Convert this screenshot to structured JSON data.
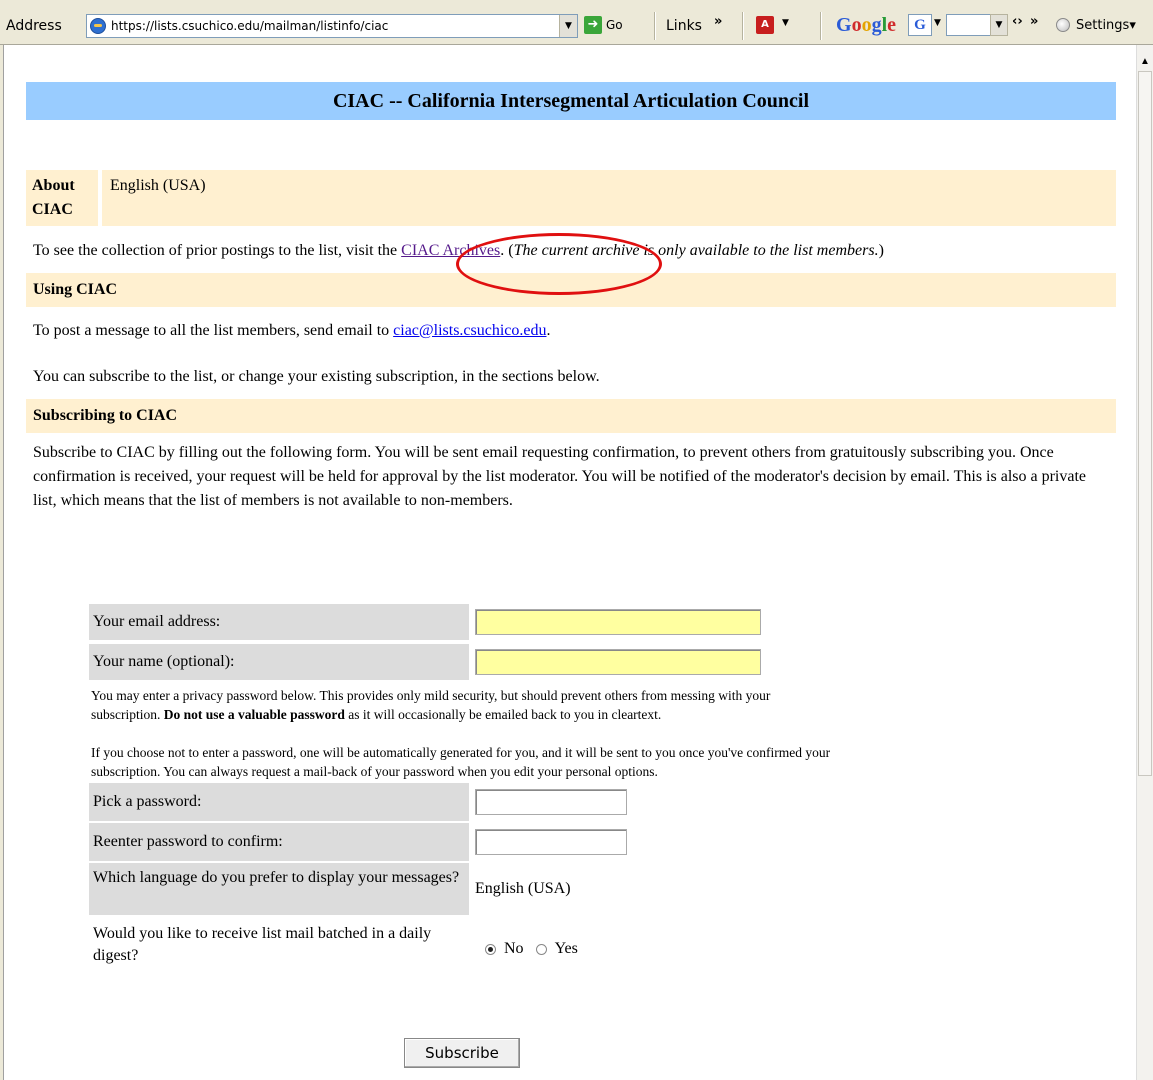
{
  "toolbar": {
    "address_label": "Address",
    "url": "https://lists.csuchico.edu/mailman/listinfo/ciac",
    "go_label": "Go",
    "links_label": "Links",
    "google_label": "Google",
    "settings_label": "Settings"
  },
  "page": {
    "title": "CIAC -- California Intersegmental Articulation Council",
    "about_head": "About CIAC",
    "about_value": "English (USA)",
    "archives_pre": "To see the collection of prior postings to the list, visit the ",
    "archives_link": "CIAC Archives",
    "archives_post": ". (",
    "archives_italic": "The current archive is only available to the list members.",
    "archives_end": ")",
    "using_head": "Using CIAC",
    "post_pre": "To post a message to all the list members, send email to ",
    "post_email": "ciac@lists.csuchico.edu",
    "post_end": ".",
    "change_text": "You can subscribe to the list, or change your existing subscription, in the sections below.",
    "subscribing_head": "Subscribing to CIAC",
    "subscribe_desc": "Subscribe to CIAC by filling out the following form. You will be sent email requesting confirmation, to prevent others from gratuitously subscribing you. Once confirmation is received, your request will be held for approval by the list moderator. You will be notified of the moderator's decision by email. This is also a private list, which means that the list of members is not available to non-members."
  },
  "form": {
    "email_label": "Your email address:",
    "name_label": "Your name (optional):",
    "privacy_pre": "You may enter a privacy password below. This provides only mild security, but should prevent others from messing with your subscription. ",
    "privacy_bold": "Do not use a valuable password",
    "privacy_post": " as it will occasionally be emailed back to you in cleartext.",
    "auto_password": "If you choose not to enter a password, one will be automatically generated for you, and it will be sent to you once you've confirmed your subscription. You can always request a mail-back of your password when you edit your personal options.",
    "pick_password_label": "Pick a password:",
    "reenter_label": "Reenter password to confirm:",
    "language_label": "Which language do you prefer to display your messages?",
    "language_value": "English (USA)",
    "digest_label": "Would you like to receive list mail batched in a daily digest?",
    "digest_no": "No",
    "digest_yes": "Yes",
    "subscribe_button": "Subscribe"
  }
}
